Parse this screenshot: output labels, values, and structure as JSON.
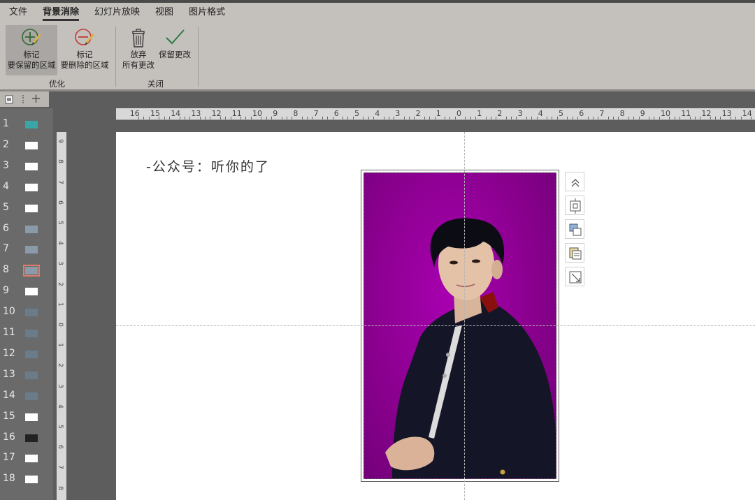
{
  "menu": {
    "items": [
      "文件",
      "背景消除",
      "幻灯片放映",
      "视图",
      "图片格式"
    ],
    "active_index": 1
  },
  "ribbon": {
    "mark_keep": {
      "line1": "标记",
      "line2": "要保留的区域"
    },
    "mark_remove": {
      "line1": "标记",
      "line2": "要删除的区域"
    },
    "discard": {
      "line1": "放弃",
      "line2": "所有更改"
    },
    "keep_changes": {
      "line1": "保留更改"
    },
    "group_refine": "优化",
    "group_close": "关闭"
  },
  "thumbnails": {
    "numbers": [
      "1",
      "2",
      "3",
      "4",
      "5",
      "6",
      "7",
      "8",
      "9",
      "10",
      "11",
      "12",
      "13",
      "14",
      "15",
      "16",
      "17",
      "18"
    ],
    "selected": "8"
  },
  "hruler_labels": [
    "16",
    "15",
    "14",
    "13",
    "12",
    "11",
    "10",
    "9",
    "8",
    "7",
    "6",
    "5",
    "4",
    "3",
    "2",
    "1",
    "0",
    "1",
    "2",
    "3",
    "4",
    "5",
    "6",
    "7",
    "8",
    "9",
    "10",
    "11",
    "12",
    "13",
    "14"
  ],
  "vruler_labels": [
    "9",
    "8",
    "7",
    "6",
    "5",
    "4",
    "3",
    "2",
    "1",
    "0",
    "1",
    "2",
    "3",
    "4",
    "5",
    "6",
    "7",
    "8"
  ],
  "slide": {
    "title": "-公众号：听你的了"
  },
  "colors": {
    "ribbon_bg": "#c4c0bc",
    "background_magenta": "#8a008e",
    "selected_thumb_outline": "#e07b6a"
  },
  "icons": {
    "mark_keep": "pencil-plus-icon",
    "mark_remove": "pencil-minus-icon",
    "discard": "trash-icon",
    "keep": "checkmark-icon",
    "side_tools": [
      "collapse-up-icon",
      "layout-options-icon",
      "arrange-icon",
      "crop-icon",
      "resize-icon"
    ]
  }
}
